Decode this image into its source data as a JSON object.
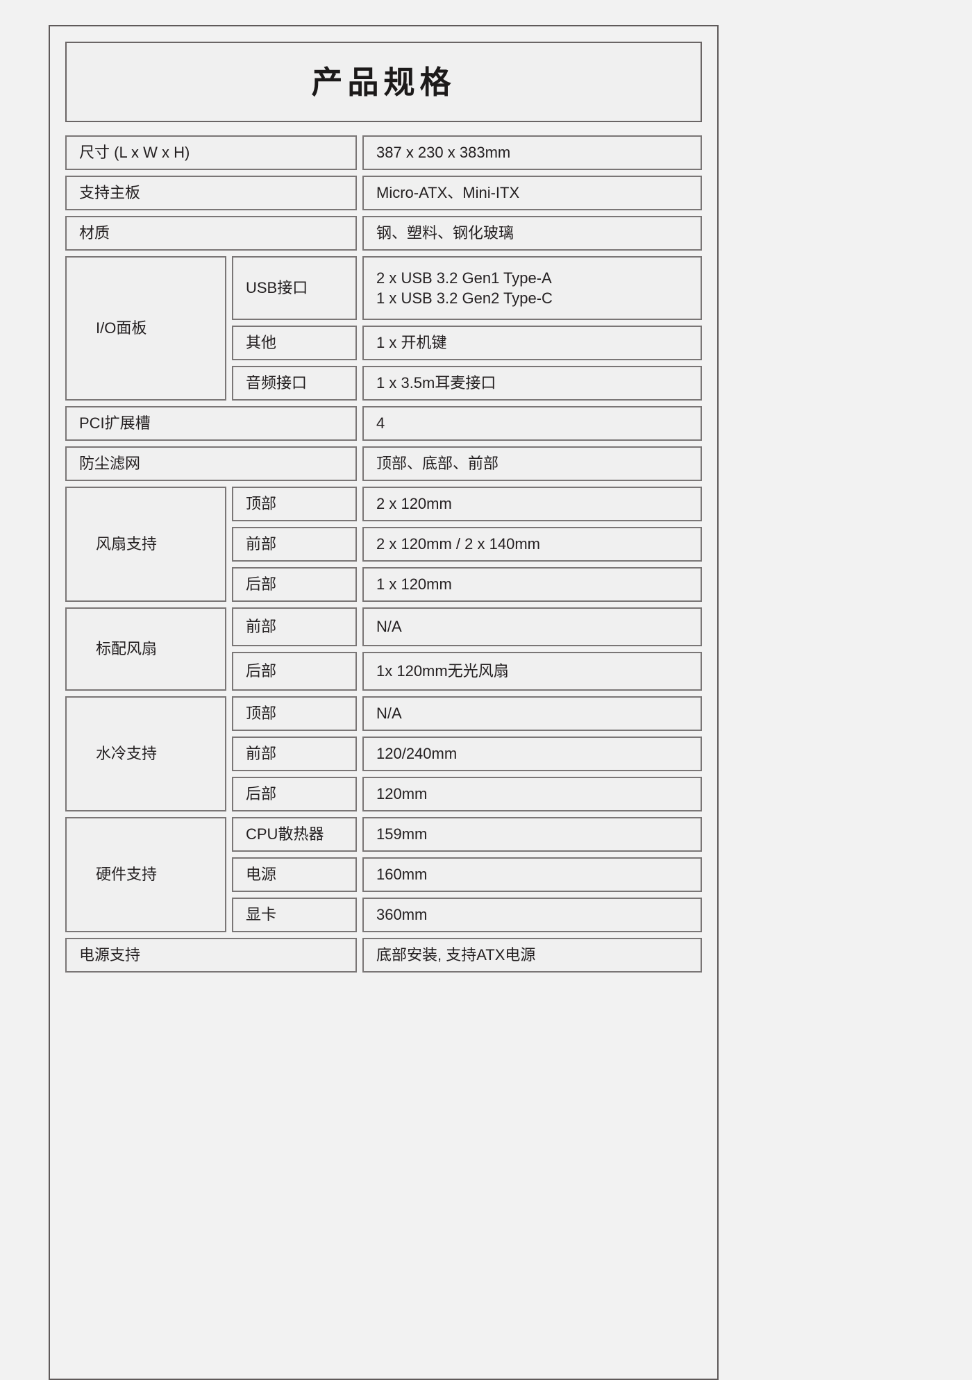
{
  "header": {
    "title": "产品规格"
  },
  "rows": [
    {
      "label": "尺寸 (L x W x H)",
      "value": "387 x 230 x 383mm"
    },
    {
      "label": "支持主板",
      "value": "Micro-ATX、Mini-ITX"
    },
    {
      "label": "材质",
      "value": "钢、塑料、钢化玻璃"
    }
  ],
  "io_panel": {
    "label": "I/O面板",
    "items": [
      {
        "sub_label": "USB接口",
        "value_line1": "2 x USB 3.2 Gen1 Type-A",
        "value_line2": "1 x USB 3.2 Gen2 Type-C"
      },
      {
        "sub_label": "其他",
        "value": "1 x 开机键"
      },
      {
        "sub_label": "音频接口",
        "value": "1 x 3.5m耳麦接口"
      }
    ]
  },
  "rows2": [
    {
      "label": "PCI扩展槽",
      "value": "4"
    },
    {
      "label": "防尘滤网",
      "value": "顶部、底部、前部"
    }
  ],
  "fan_support": {
    "label": "风扇支持",
    "items": [
      {
        "sub_label": "顶部",
        "value": "2 x 120mm"
      },
      {
        "sub_label": "前部",
        "value": "2 x 120mm / 2 x 140mm"
      },
      {
        "sub_label": "后部",
        "value": "1 x 120mm"
      }
    ]
  },
  "stock_fan": {
    "label": "标配风扇",
    "items": [
      {
        "sub_label": "前部",
        "value": "N/A"
      },
      {
        "sub_label": "后部",
        "value": "1x 120mm无光风扇"
      }
    ]
  },
  "liquid_cooling": {
    "label": "水冷支持",
    "items": [
      {
        "sub_label": "顶部",
        "value": "N/A"
      },
      {
        "sub_label": "前部",
        "value": "120/240mm"
      },
      {
        "sub_label": "后部",
        "value": "120mm"
      }
    ]
  },
  "hardware_support": {
    "label": "硬件支持",
    "items": [
      {
        "sub_label": "CPU散热器",
        "value": "159mm"
      },
      {
        "sub_label": "电源",
        "value": "160mm"
      },
      {
        "sub_label": "显卡",
        "value": "360mm"
      }
    ]
  },
  "psu_support": {
    "label": "电源支持",
    "value": "底部安装, 支持ATX电源"
  }
}
